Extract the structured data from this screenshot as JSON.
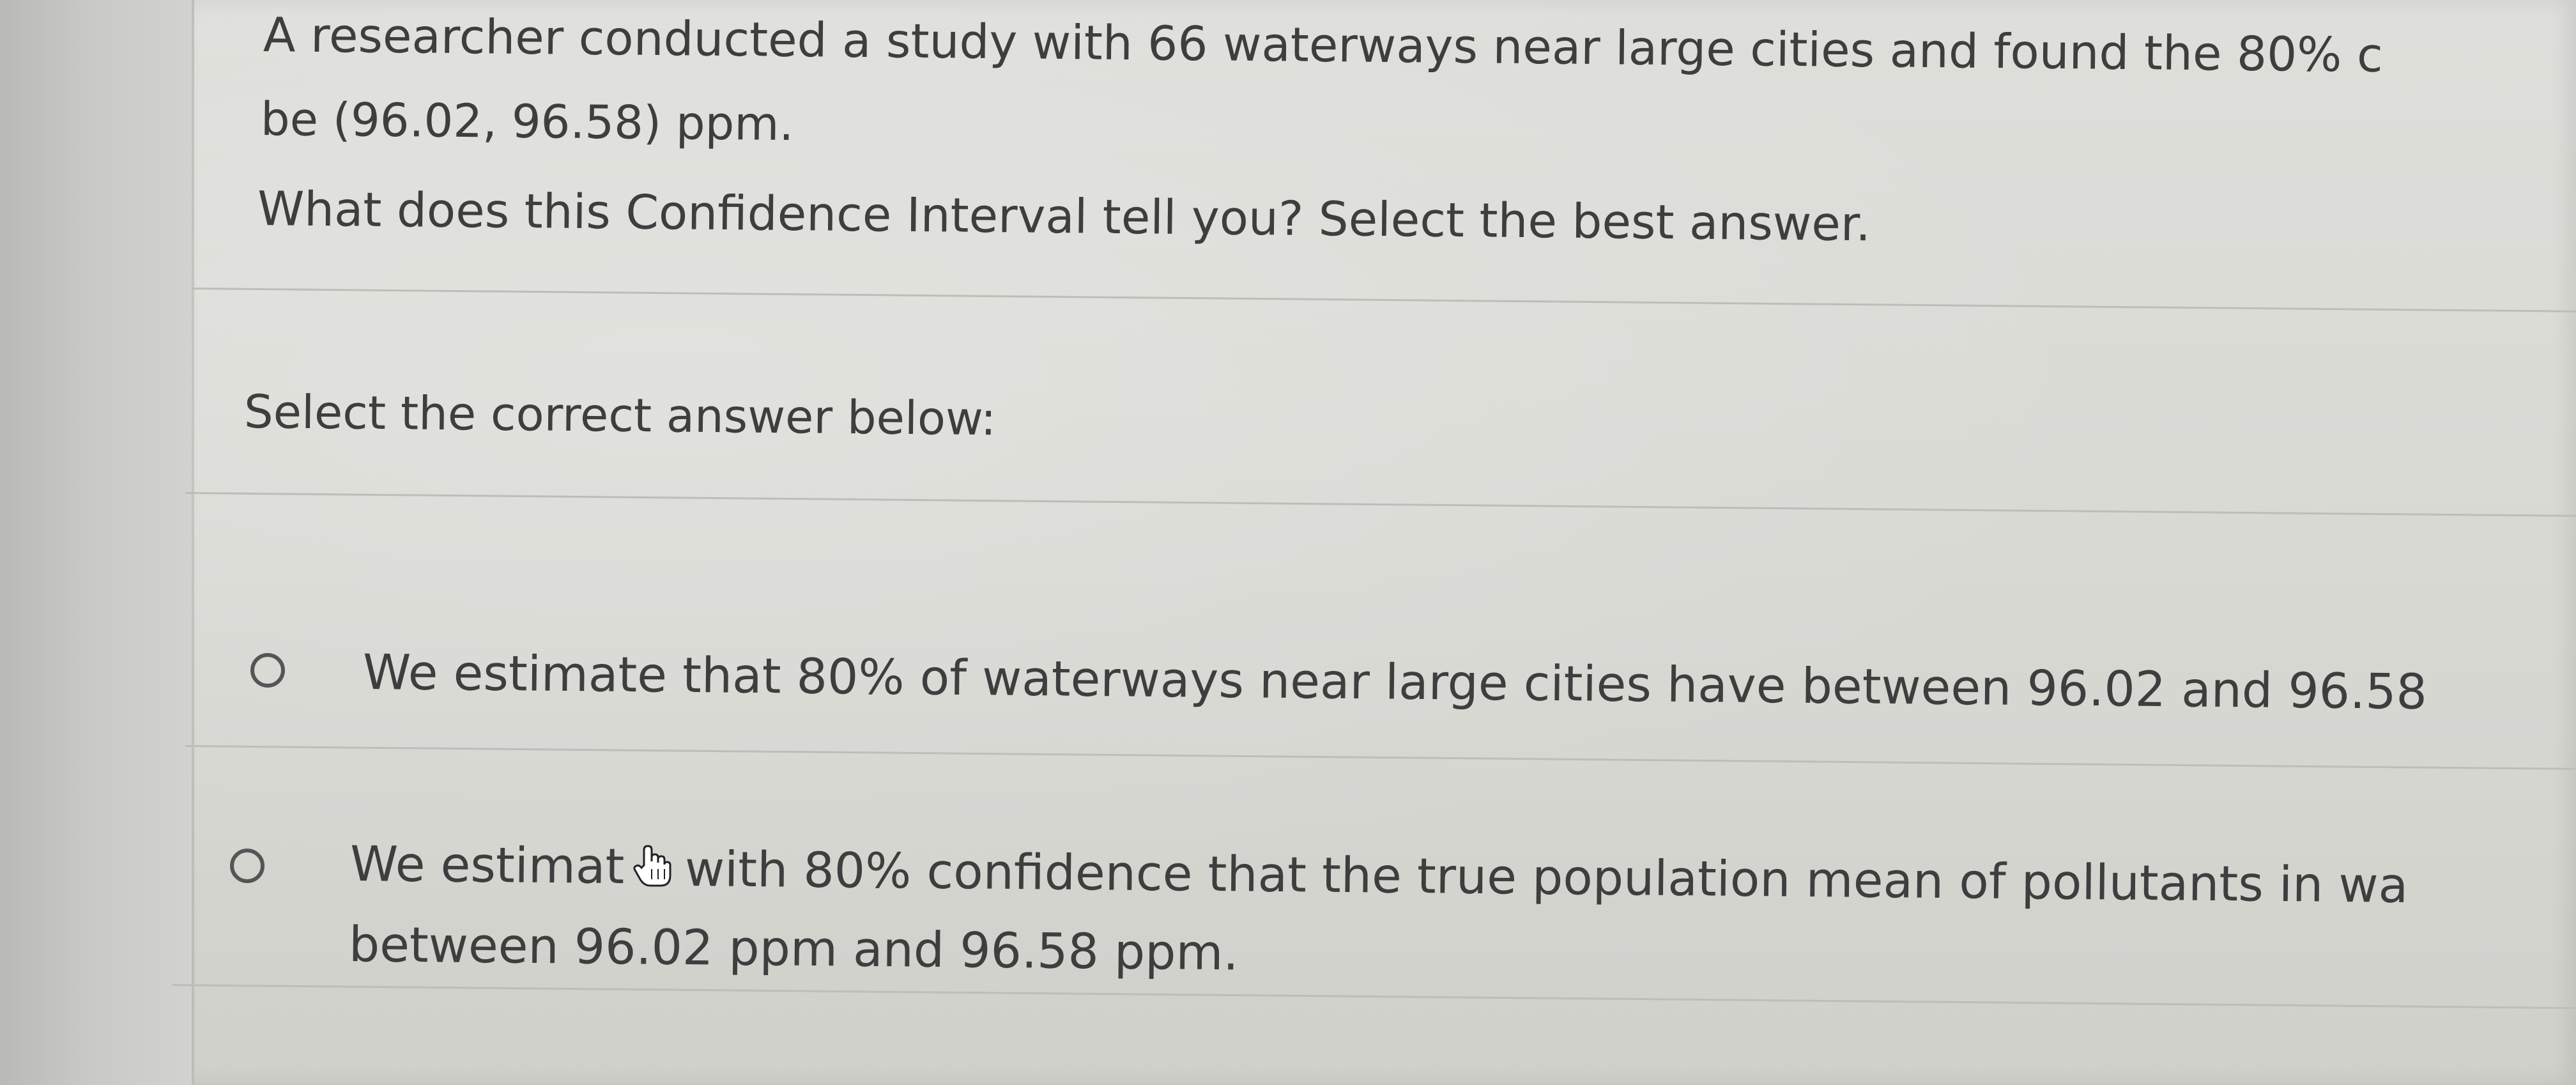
{
  "question": {
    "line1": "A researcher conducted a study with 66 waterways near large cities and found the 80% c",
    "line2": "be (96.02, 96.58) ppm.",
    "line3": "What does this Confidence Interval tell you? Select the best answer."
  },
  "instructions": {
    "label": "Select the correct answer below:"
  },
  "options": [
    {
      "line1": "We estimate that 80% of waterways near large cities have between 96.02 and 96.58",
      "line2": ""
    },
    {
      "line1a": "We estimat",
      "line1b": "with 80% confidence that the true population mean of pollutants in wa",
      "line2": "between 96.02 ppm and 96.58 ppm."
    }
  ],
  "icons": {
    "radio": "radio-button-icon",
    "cursor": "hand-pointer-icon"
  },
  "colors": {
    "text": "#3e3e3e",
    "background": "#dbdbd6",
    "divider": "#bebeb8"
  }
}
